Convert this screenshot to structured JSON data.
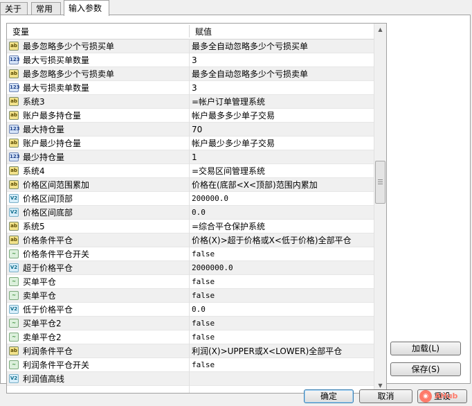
{
  "tabs": [
    {
      "label": "关于"
    },
    {
      "label": "常用"
    },
    {
      "label": "输入参数"
    }
  ],
  "grid": {
    "col_variable": "变量",
    "col_value": "赋值",
    "rows": [
      {
        "type": "ab",
        "icon": "ab",
        "name": "最多忽略多少个亏损买单",
        "value": "最多全自动忽略多少个亏损买单"
      },
      {
        "type": "num",
        "icon": "123",
        "name": "最大亏损买单数量",
        "value": "3"
      },
      {
        "type": "ab",
        "icon": "ab",
        "name": "最多忽略多少个亏损卖单",
        "value": "最多全自动忽略多少个亏损卖单"
      },
      {
        "type": "num",
        "icon": "123",
        "name": "最大亏损卖单数量",
        "value": "3"
      },
      {
        "type": "ab",
        "icon": "ab",
        "name": "系统3",
        "value": "=帐户订单管理系统"
      },
      {
        "type": "ab",
        "icon": "ab",
        "name": "账户最多持仓量",
        "value": "帐户最多多少单子交易"
      },
      {
        "type": "num",
        "icon": "123",
        "name": "最大持仓量",
        "value": "70"
      },
      {
        "type": "ab",
        "icon": "ab",
        "name": "账户最少持仓量",
        "value": "帐户最少多少单子交易"
      },
      {
        "type": "num",
        "icon": "123",
        "name": "最少持仓量",
        "value": "1"
      },
      {
        "type": "ab",
        "icon": "ab",
        "name": "系统4",
        "value": "=交易区间管理系统"
      },
      {
        "type": "ab",
        "icon": "ab",
        "name": "价格区间范围累加",
        "value": "价格在(底部<X<顶部)范围内累加"
      },
      {
        "type": "dbl",
        "icon": "V2",
        "name": "价格区间顶部",
        "value": "200000.0"
      },
      {
        "type": "dbl",
        "icon": "V2",
        "name": "价格区间底部",
        "value": "0.0"
      },
      {
        "type": "ab",
        "icon": "ab",
        "name": "系统5",
        "value": "=综合平仓保护系统"
      },
      {
        "type": "ab",
        "icon": "ab",
        "name": "价格条件平仓",
        "value": "价格(X)>超于价格或X<低于价格)全部平仓"
      },
      {
        "type": "bool",
        "icon": "~",
        "name": "价格条件平仓开关",
        "value": "false"
      },
      {
        "type": "dbl",
        "icon": "V2",
        "name": "超于价格平仓",
        "value": "2000000.0"
      },
      {
        "type": "bool",
        "icon": "~",
        "name": "买单平仓",
        "value": "false"
      },
      {
        "type": "bool",
        "icon": "~",
        "name": "卖单平仓",
        "value": "false"
      },
      {
        "type": "dbl",
        "icon": "V2",
        "name": "低于价格平仓",
        "value": "0.0"
      },
      {
        "type": "bool",
        "icon": "~",
        "name": "买单平仓2",
        "value": "false"
      },
      {
        "type": "bool",
        "icon": "~",
        "name": "卖单平仓2",
        "value": "false"
      },
      {
        "type": "ab",
        "icon": "ab",
        "name": "利润条件平仓",
        "value": "利润(X)>UPPER或X<LOWER)全部平仓"
      },
      {
        "type": "bool",
        "icon": "~",
        "name": "利润条件平仓开关",
        "value": "false"
      },
      {
        "type": "dbl",
        "icon": "V2",
        "name": "利润值高线",
        "value": ""
      }
    ]
  },
  "buttons": {
    "load": "加载(L)",
    "save": "保存(S)",
    "ok": "确定",
    "cancel": "取消",
    "reset": "重设"
  },
  "watermark": {
    "text": "AHub"
  }
}
